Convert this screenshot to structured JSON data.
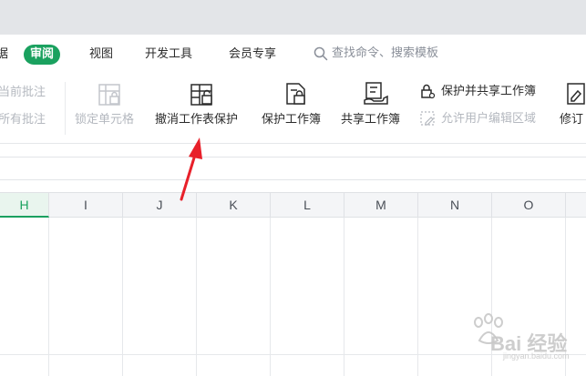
{
  "menu": {
    "partial_first": "据",
    "active_tab": "审阅",
    "items": [
      "视图",
      "开发工具",
      "会员专享"
    ],
    "search_placeholder": "查找命令、搜索模板"
  },
  "ribbon": {
    "cut_left_top": "当前批注",
    "cut_left_bottom": "所有批注",
    "lock_cell": "锁定单元格",
    "unprotect_sheet": "撤消工作表保护",
    "protect_workbook": "保护工作簿",
    "share_workbook": "共享工作簿",
    "protect_and_share": "保护并共享工作簿",
    "allow_edit_ranges": "允许用户编辑区域",
    "partial_right": "修订"
  },
  "columns": [
    "H",
    "I",
    "J",
    "K",
    "L",
    "M",
    "N",
    "O"
  ],
  "active_column": "H",
  "watermark": {
    "logo": "Bai 经验",
    "url": "jingyan.baidu.com"
  },
  "colors": {
    "accent": "#1aa15f",
    "arrow": "#e8202a"
  }
}
